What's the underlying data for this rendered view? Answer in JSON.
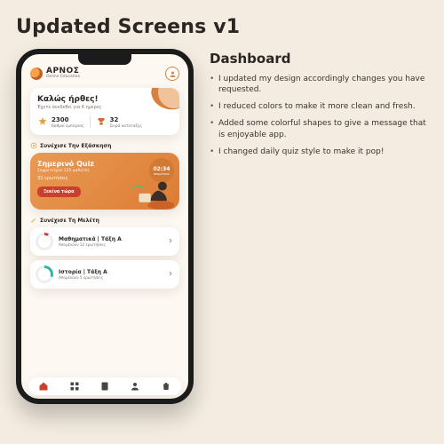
{
  "page": {
    "title": "Updated Screens v1"
  },
  "side": {
    "heading": "Dashboard",
    "bullets": [
      "I updated my design accordingly changes you have requested.",
      "I reduced colors to make it more clean and fresh.",
      "Added some colorful shapes to give a message that is enjoyable app.",
      "I changed daily quiz style to make it pop!"
    ]
  },
  "brand": {
    "name": "ΑΡΝΟΣ",
    "sub": "Online Education"
  },
  "welcome": {
    "title": "Καλώς ήρθες!",
    "sub": "Έχετε συνδεθεί για 6 ημέρες",
    "stat1_value": "2300",
    "stat1_label": "Βαθμοί εμπειρίας",
    "stat2_value": "32",
    "stat2_label": "Σειρά κατάταξης"
  },
  "sections": {
    "practice": "Συνέχισε Την Εξάσκηση",
    "study": "Συνέχισε Τη Μελέτη"
  },
  "quiz": {
    "title": "Σημερινό Quiz",
    "sub": "Συμμετείχαν 120 μαθητές",
    "count": "32 ερωτήσεις",
    "cta": "Ξεκίνα τώρα",
    "timer_value": "02:34",
    "timer_label": "απομένουν"
  },
  "study": {
    "items": [
      {
        "pct": "8",
        "pct_suffix": "%",
        "title": "Μαθηματικά | Τάξη Α",
        "sub": "Απομένουν 12 ερωτήσεις",
        "color": "#c9412e"
      },
      {
        "pct": "30",
        "pct_suffix": "%",
        "title": "Ιστορία | Τάξη Α",
        "sub": "Απομένουν 5 ερωτήσεις",
        "color": "#2fb6a1"
      }
    ]
  },
  "tabs": [
    "home",
    "grid",
    "notes",
    "profile",
    "bag"
  ]
}
